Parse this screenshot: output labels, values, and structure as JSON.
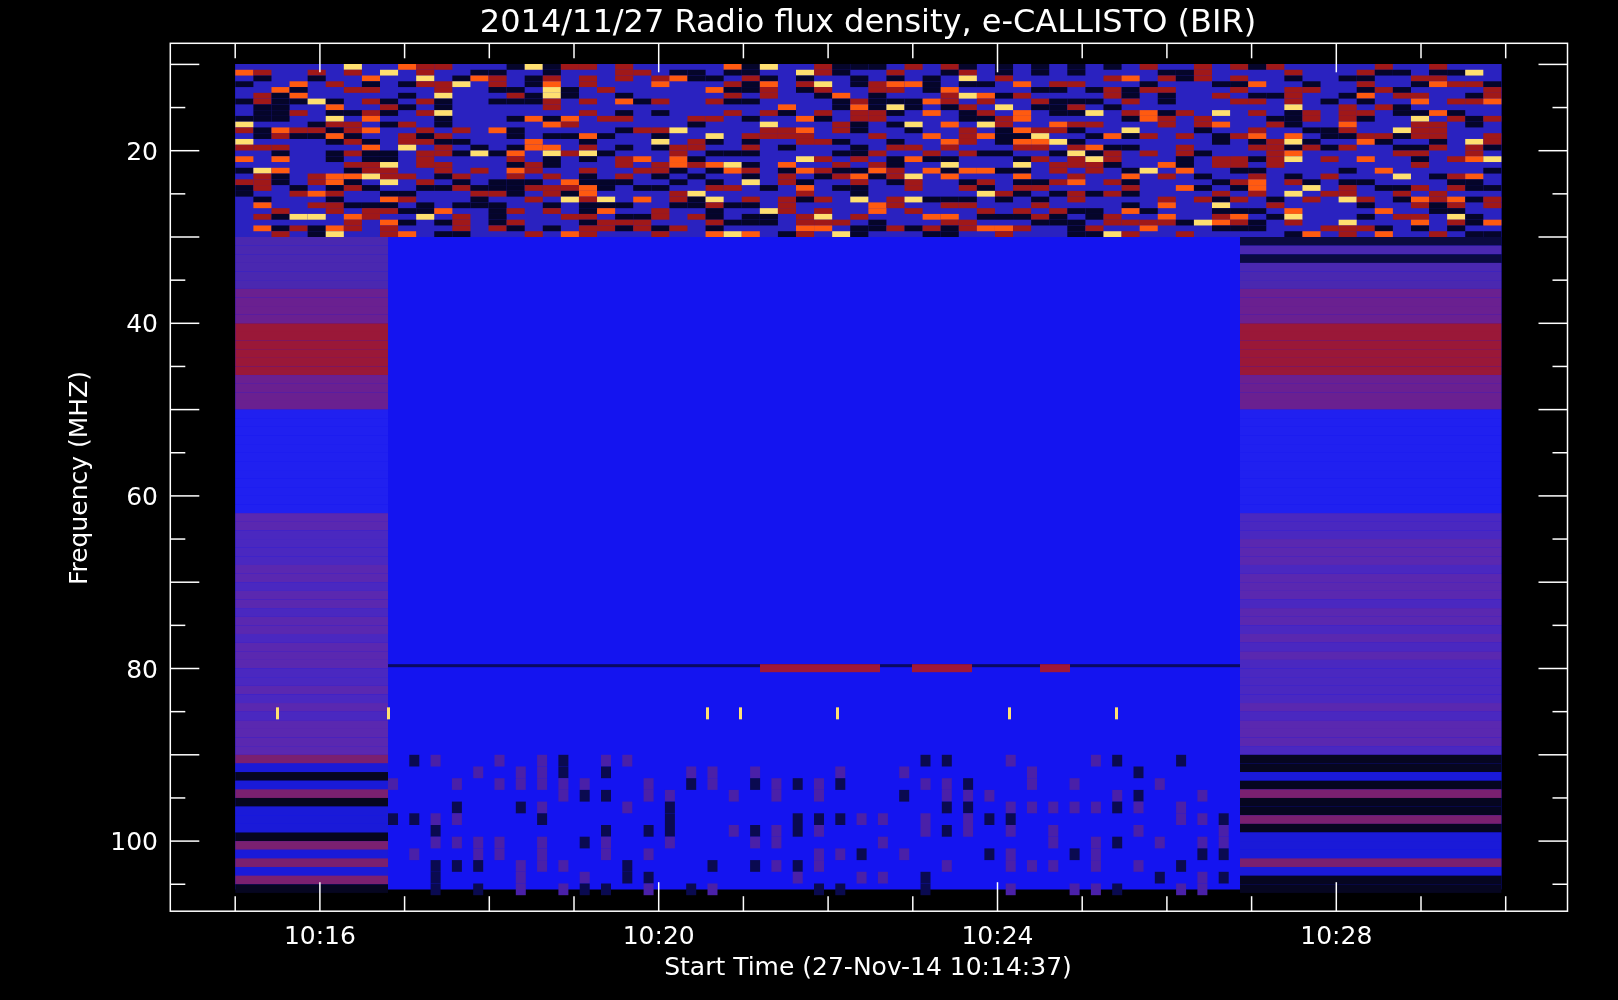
{
  "title": "2014/11/27  Radio flux density, e-CALLISTO (BIR)",
  "x_axis": {
    "label": "Start Time (27-Nov-14 10:14:37)",
    "ticks": [
      "10:16",
      "10:20",
      "10:24",
      "10:28"
    ]
  },
  "y_axis": {
    "label": "Frequency (MHZ)",
    "ticks": [
      "20",
      "40",
      "60",
      "80",
      "100"
    ]
  }
}
